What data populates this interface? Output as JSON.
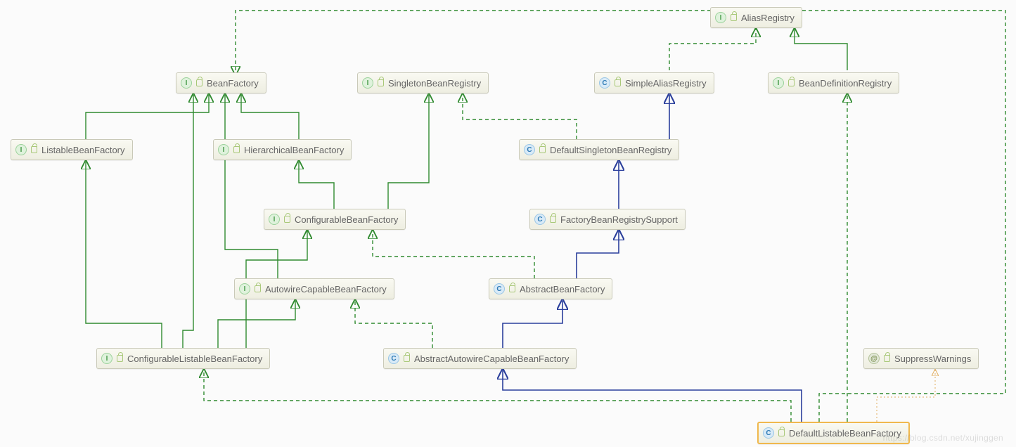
{
  "nodes": {
    "aliasRegistry": {
      "label": "AliasRegistry",
      "kind": "I"
    },
    "beanFactory": {
      "label": "BeanFactory",
      "kind": "I"
    },
    "singletonBeanRegistry": {
      "label": "SingletonBeanRegistry",
      "kind": "I"
    },
    "simpleAliasRegistry": {
      "label": "SimpleAliasRegistry",
      "kind": "C"
    },
    "beanDefinitionRegistry": {
      "label": "BeanDefinitionRegistry",
      "kind": "I"
    },
    "listableBeanFactory": {
      "label": "ListableBeanFactory",
      "kind": "I"
    },
    "hierarchicalBeanFactory": {
      "label": "HierarchicalBeanFactory",
      "kind": "I"
    },
    "defaultSingletonBeanRegistry": {
      "label": "DefaultSingletonBeanRegistry",
      "kind": "C"
    },
    "configurableBeanFactory": {
      "label": "ConfigurableBeanFactory",
      "kind": "I"
    },
    "factoryBeanRegistrySupport": {
      "label": "FactoryBeanRegistrySupport",
      "kind": "C"
    },
    "autowireCapableBeanFactory": {
      "label": "AutowireCapableBeanFactory",
      "kind": "I"
    },
    "abstractBeanFactory": {
      "label": "AbstractBeanFactory",
      "kind": "C"
    },
    "configurableListableBeanFactory": {
      "label": "ConfigurableListableBeanFactory",
      "kind": "I"
    },
    "abstractAutowireCapableBeanFactory": {
      "label": "AbstractAutowireCapableBeanFactory",
      "kind": "C"
    },
    "suppressWarnings": {
      "label": "SuppressWarnings",
      "kind": "A"
    },
    "defaultListableBeanFactory": {
      "label": "DefaultListableBeanFactory",
      "kind": "C"
    }
  },
  "iconGlyph": {
    "I": "I",
    "C": "C",
    "A": "@"
  },
  "watermark": "https://blog.csdn.net/xujinggen"
}
